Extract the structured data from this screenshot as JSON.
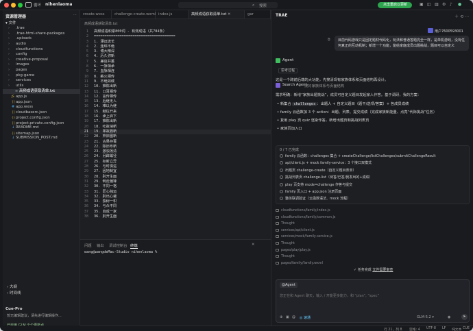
{
  "titlebar": {
    "menu_label": "循环",
    "project": "nihenlaoma",
    "search_label": "搜索",
    "update_label": "点击重启以更新",
    "icons": [
      "layout-icon",
      "split-icon",
      "sidebar-icon",
      "user-icon"
    ]
  },
  "explorer": {
    "title": "资源管理器",
    "root": "文件",
    "items": [
      {
        "label": ".trae",
        "type": "folder",
        "indent": 1
      },
      {
        "label": ".trae-html-share-packages",
        "type": "folder",
        "indent": 1
      },
      {
        "label": ".uploads",
        "type": "folder",
        "indent": 1
      },
      {
        "label": "audio",
        "type": "folder",
        "indent": 1
      },
      {
        "label": "cloudfunctions",
        "type": "folder",
        "indent": 1
      },
      {
        "label": "config",
        "type": "folder",
        "indent": 1
      },
      {
        "label": "creative-proposal",
        "type": "folder",
        "indent": 1
      },
      {
        "label": "images",
        "type": "folder",
        "indent": 1
      },
      {
        "label": "pages",
        "type": "folder",
        "indent": 1
      },
      {
        "label": "pkg-game",
        "type": "folder",
        "indent": 1
      },
      {
        "label": "services",
        "type": "folder",
        "indent": 1
      },
      {
        "label": "utils",
        "type": "folder",
        "indent": 1
      },
      {
        "label": "高频成语获取清单.txt",
        "type": "txt",
        "indent": 2,
        "selected": true
      },
      {
        "label": "app.js",
        "type": "js",
        "indent": 1
      },
      {
        "label": "app.json",
        "type": "json",
        "indent": 1
      },
      {
        "label": "app.wxss",
        "type": "wxss",
        "indent": 1
      },
      {
        "label": "cloudbaserc.json",
        "type": "json",
        "indent": 1
      },
      {
        "label": "project.config.json",
        "type": "json",
        "indent": 1
      },
      {
        "label": "project.private.config.json",
        "type": "json",
        "indent": 1
      },
      {
        "label": "README.md",
        "type": "md",
        "indent": 1
      },
      {
        "label": "sitemap.json",
        "type": "json",
        "indent": 1
      },
      {
        "label": "SUBMISSION_POST.md",
        "type": "md",
        "indent": 1
      }
    ],
    "outline_label": "大纲",
    "timeline_label": "时间线",
    "cue_title": "Cue-Pro",
    "cue_sub": "暂无编辑建议，请先进行编辑操作...",
    "cue_status": "已启用 GLM 个个更新点"
  },
  "editor": {
    "tabs": [
      {
        "label": "create.wxss",
        "active": false
      },
      {
        "label": "challenge-create.wxml",
        "active": false
      },
      {
        "label": "index.js",
        "active": false
      },
      {
        "label": "高频成语获取清单.txt",
        "active": true
      },
      {
        "label": "gar",
        "active": false
      }
    ],
    "breadcrumb": "高频成语获取清单.txt",
    "current_line": 21,
    "lines": [
      {
        "n": "1",
        "t": "高频成语积累800词 - 有效成语（共784条）"
      },
      {
        "n": "2",
        "t": "======================================"
      },
      {
        "n": "3",
        "t": "1. 漂远流长"
      },
      {
        "n": "4",
        "t": "2. 连绵不绝"
      },
      {
        "n": "5",
        "t": "3. 博大精深"
      },
      {
        "n": "6",
        "t": "4. 历久弥新"
      },
      {
        "n": "7",
        "t": "5. 兼容并蓄"
      },
      {
        "n": "8",
        "t": "6. 一脉相承"
      },
      {
        "n": "9",
        "t": "7. 血脉相连"
      },
      {
        "n": "10",
        "t": "8. 薪火相传"
      },
      {
        "n": "11",
        "t": "9. 不绝如缕"
      },
      {
        "n": "12",
        "t": "10. 推陈出新"
      },
      {
        "n": "13",
        "t": "11. 口耳相传"
      },
      {
        "n": "14",
        "t": "12. 言传相传"
      },
      {
        "n": "15",
        "t": "13. 后继无人"
      },
      {
        "n": "16",
        "t": "14. 难以为继"
      },
      {
        "n": "17",
        "t": "15. 继往开来"
      },
      {
        "n": "18",
        "t": "16. 承上启下"
      },
      {
        "n": "19",
        "t": "17. 推陈出新"
      },
      {
        "n": "20",
        "t": "18. 吐故纳新"
      },
      {
        "n": "21",
        "t": "19. 革故鼎新"
      },
      {
        "n": "22",
        "t": "20. 弃旧图新"
      },
      {
        "n": "23",
        "t": "21. 古果存菁"
      },
      {
        "n": "24",
        "t": "22. 除旧布新"
      },
      {
        "n": "25",
        "t": "23. 激浊扬清"
      },
      {
        "n": "26",
        "t": "24. 另辟蹊径"
      },
      {
        "n": "27",
        "t": "25. 标新立异"
      },
      {
        "n": "28",
        "t": "26. 与时俱进"
      },
      {
        "n": "29",
        "t": "27. 因地制宜"
      },
      {
        "n": "30",
        "t": "28. 别开生面"
      },
      {
        "n": "31",
        "t": "29. 倒走偏锋"
      },
      {
        "n": "32",
        "t": "30. 不同一格"
      },
      {
        "n": "33",
        "t": "31. 匠心独运"
      },
      {
        "n": "34",
        "t": "32. 别出心裁"
      },
      {
        "n": "35",
        "t": "33. 独树一帜"
      },
      {
        "n": "36",
        "t": "34. 与众不同"
      },
      {
        "n": "37",
        "t": "35. 自成一家"
      },
      {
        "n": "38",
        "t": "36. 别开生面"
      }
    ],
    "panel_tabs": [
      "问题",
      "输出",
      "调试控制台",
      "终端"
    ],
    "panel_active": "终端",
    "terminal_line": "wang@wangdeMac-Studio nihenlaoma %"
  },
  "status": {
    "items": [
      "行 21，列 8",
      "空格: 4",
      "UTF-8",
      "LF",
      "纯文本",
      "CUE"
    ]
  },
  "chat": {
    "title": "TRAE",
    "user_name": "用户7600593001",
    "user_message": "目前代码游戏只是固定题材代码化，玩法和普通答题完全一样，是单机游戏，没有任何真正的互动机制；新增一个功能，能给家庭成员出题挑战，题目可以自定义",
    "agent_label": "Agent",
    "think_label": "思考过程",
    "intro_text": "这是一个跨前后端的大功能，先搜清现有家族体系和页面结构再设计。",
    "search_agent_label": "Search Agent",
    "search_agent_text": "搜好家族体系与页面结构",
    "need_text": "需求明确：新增“家族出题挑战”，成员可自定义题目发起家人作答。基于调研，我的方案：",
    "bullets": [
      {
        "pre": "新集合 ",
        "chip": "challenges",
        "post": "：出题人 + 自定义题目（题干/选项/答案）+ 各成员成绩"
      },
      {
        "pre": "family 云函数加 3 个 action：出题、列表、提交成绩（完成家族新能量、点亮“代际挑战”任务）",
        "chip": "",
        "post": ""
      },
      {
        "pre": "复用 play 页 quiz 渲染作答，新增出题页和挑战列表页",
        "chip": "",
        "post": ""
      },
      {
        "pre": "家族页加入口",
        "chip": "",
        "post": ""
      }
    ],
    "todo_head": "0 / 7 已完成",
    "todos": [
      "family 云函数：challenges 集合 + createChallenge/listChallenges/submitChallengeResult",
      "api/client.js + mock family-service：3 个接口双模式",
      "出题页 challenge-create（自定义题目表单）",
      "挑战列表页 challenge-list（待答/已答/我发出的+成绩）",
      "play 页支持 mode=challenge 作答与提交",
      "family 页入口 + app.json 注册页面",
      "整体联调验证（云函数语法、mock 流程）"
    ],
    "files": [
      "cloudfunctions/family/index.js",
      "cloudfunctions/family/common.js",
      "Thought",
      "services/api/client.js",
      "services/mock/family-service.js",
      "Thought",
      "pages/play/play.js",
      "Thought",
      "pages/family/family.wxml"
    ],
    "task_label": "任务完成",
    "task_file": "文件需要审查",
    "input_agent": "@Agent",
    "input_placeholder": "您正在和 Agent 聊天，输入 / 开能更多能力，和 “plan”, “spec”",
    "model": "GLM-5.2",
    "mode_label": "速通"
  }
}
